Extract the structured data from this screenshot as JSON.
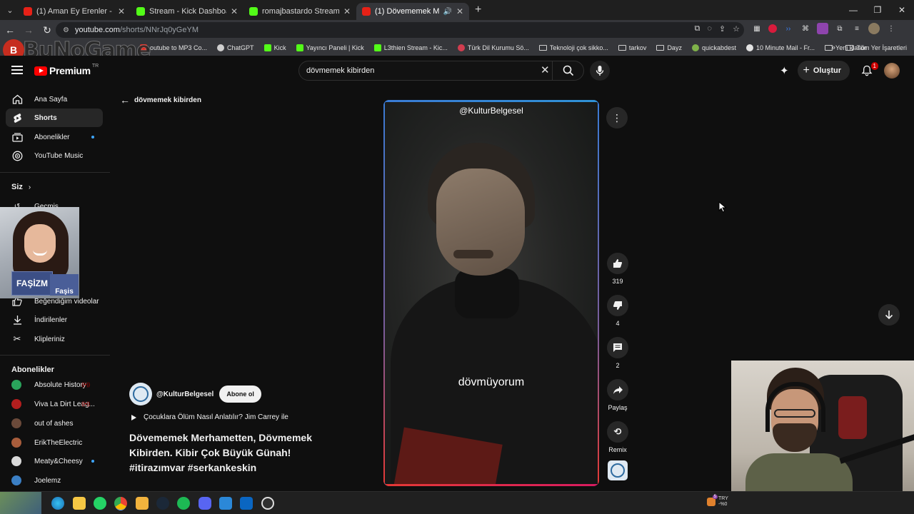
{
  "browser": {
    "tabs": [
      {
        "title": "(1) Aman Ey Erenler - Akdeniz Ezgi",
        "icon": "youtube-icon",
        "active": false
      },
      {
        "title": "Stream - Kick Dashboard",
        "icon": "kick-icon",
        "active": false
      },
      {
        "title": "romajbastardo Stream - Watch",
        "icon": "kick-icon",
        "active": false
      },
      {
        "title": "(1) Dövememek Merhamet",
        "icon": "youtube-icon",
        "active": true
      }
    ],
    "url_host": "youtube.com",
    "url_path": "/shorts/NNrJq0yGeYM",
    "bookmarks": [
      {
        "label": "outube to MP3 Co...",
        "color": "#e62117"
      },
      {
        "label": "ChatGPT",
        "color": "#cfcfcf"
      },
      {
        "label": "Kick",
        "color": "#53fc18"
      },
      {
        "label": "Yayıncı Paneli | Kick",
        "color": "#53fc18"
      },
      {
        "label": "L3thien Stream - Kic...",
        "color": "#53fc18"
      },
      {
        "label": "Türk Dil Kurumu Sö...",
        "color": "#d23d4f"
      },
      {
        "label": "Teknoloji çok sikko...",
        "folder": true
      },
      {
        "label": "tarkov",
        "folder": true
      },
      {
        "label": "Dayz",
        "folder": true
      },
      {
        "label": "quickabdest",
        "color": "#7fb24a"
      },
      {
        "label": "10 Minute Mail - Fr...",
        "color": "#e3e3e3"
      },
      {
        "label": "Yeni klasör",
        "folder": true
      }
    ],
    "bookmarks_more": "»",
    "all_bookmarks": "Tüm Yer İşaretleri"
  },
  "overlay_logo": "BuNoGame",
  "youtube": {
    "logo_text": "Premium",
    "country_code": "TR",
    "search_value": "dövmemek kibirden",
    "create_label": "Oluştur",
    "notif_count": "1"
  },
  "sidebar": {
    "items": [
      {
        "label": "Ana Sayfa",
        "icon": "home-icon"
      },
      {
        "label": "Shorts",
        "icon": "shorts-icon",
        "active": true
      },
      {
        "label": "Abonelikler",
        "icon": "subscriptions-icon",
        "dot": true
      },
      {
        "label": "YouTube Music",
        "icon": "music-icon"
      }
    ],
    "you_header": "Siz",
    "you_items": [
      {
        "label": "Geçmiş",
        "icon": "history-icon"
      },
      {
        "label": "eri",
        "icon": "playlist-icon"
      },
      {
        "label": "Beğendiğim videolar",
        "icon": "like-icon"
      },
      {
        "label": "İndirilenler",
        "icon": "download-icon"
      },
      {
        "label": "Klipleriniz",
        "icon": "scissors-icon"
      }
    ],
    "subs_header": "Abonelikler",
    "subs": [
      {
        "label": "Absolute History",
        "color": "#2aa35b",
        "live": true
      },
      {
        "label": "Viva La Dirt Leag...",
        "color": "#b31e1e",
        "live": true
      },
      {
        "label": "out of ashes",
        "color": "#6b4a3a"
      },
      {
        "label": "ErikTheElectric",
        "color": "#a85d3c"
      },
      {
        "label": "Meaty&Cheesy",
        "color": "#d9d9d9",
        "dot": true
      },
      {
        "label": "Joelemz",
        "color": "#3b7fc4"
      }
    ]
  },
  "webcam_left": {
    "book1": "FAŞİZM",
    "book2": "Faşis"
  },
  "shorts": {
    "back_label": "dövmemek kibirden",
    "video_handle": "@KulturBelgesel",
    "caption": "dövmüyorum",
    "likes": "319",
    "dislikes": "4",
    "comments": "2",
    "share_label": "Paylaş",
    "remix_label": "Remix",
    "channel": "@KulturBelgesel",
    "subscribe_label": "Abone ol",
    "playlist": "Çocuklara Ölüm Nasıl Anlatılır? Jim Carrey ile",
    "title": "Dövememek Merhametten, Dövmemek Kibirden. Kibir Çok Büyük Günah! #itirazımvar #serkankeskin"
  },
  "taskbar": {
    "currency": "TRY",
    "pct": "-%0",
    "badge": "5"
  }
}
